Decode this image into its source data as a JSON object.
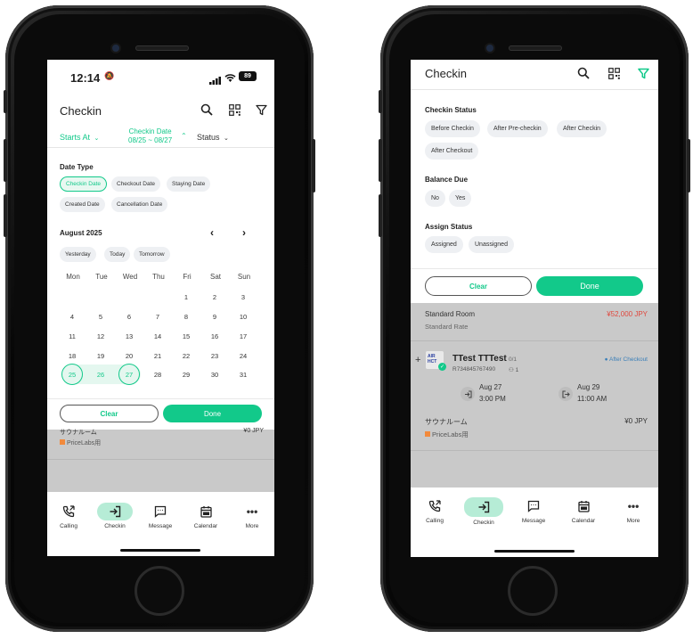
{
  "left": {
    "status": {
      "time": "12:14",
      "battery": "89"
    },
    "header": {
      "title": "Checkin"
    },
    "filters": {
      "starts_at": "Starts At",
      "checkin_date": "Checkin Date",
      "checkin_range": "08/25 ~ 08/27",
      "status": "Status"
    },
    "date_type": {
      "label": "Date Type",
      "options": [
        "Checkin Date",
        "Checkout Date",
        "Staying Date",
        "Created Date",
        "Cancellation Date"
      ],
      "selected": "Checkin Date"
    },
    "calendar": {
      "month": "August 2025",
      "quick": [
        "Yesterday",
        "Today",
        "Tomorrow"
      ],
      "weekdays": [
        "Mon",
        "Tue",
        "Wed",
        "Thu",
        "Fri",
        "Sat",
        "Sun"
      ],
      "weeks": [
        [
          "",
          "",
          "",
          "",
          "1",
          "2",
          "3"
        ],
        [
          "4",
          "5",
          "6",
          "7",
          "8",
          "9",
          "10"
        ],
        [
          "11",
          "12",
          "13",
          "14",
          "15",
          "16",
          "17"
        ],
        [
          "18",
          "19",
          "20",
          "21",
          "22",
          "23",
          "24"
        ],
        [
          "25",
          "26",
          "27",
          "28",
          "29",
          "30",
          "31"
        ]
      ],
      "range_start": "25",
      "range_end": "27"
    },
    "actions": {
      "clear": "Clear",
      "done": "Done"
    },
    "behind": {
      "room": "サウナルーム",
      "price": "¥0 JPY",
      "plan": "PriceLabs用"
    },
    "tabs": [
      "Calling",
      "Checkin",
      "Message",
      "Calendar",
      "More"
    ],
    "active_tab": "Checkin"
  },
  "right": {
    "header": {
      "title": "Checkin"
    },
    "checkin_status": {
      "label": "Checkin Status",
      "options": [
        "Before Checkin",
        "After Pre-checkin",
        "After Checkin",
        "After Checkout"
      ]
    },
    "balance_due": {
      "label": "Balance Due",
      "options": [
        "No",
        "Yes"
      ]
    },
    "assign_status": {
      "label": "Assign Status",
      "options": [
        "Assigned",
        "Unassigned"
      ]
    },
    "actions": {
      "clear": "Clear",
      "done": "Done"
    },
    "booking": {
      "room": "Standard Room",
      "rate": "Standard Rate",
      "price": "¥52,000 JPY",
      "guest": "TTest TTTest",
      "guest_count": "0/1",
      "code": "R734845767490",
      "people": "1",
      "status": "After Checkout",
      "checkin_date": "Aug 27",
      "checkin_time": "3:00 PM",
      "checkout_date": "Aug 29",
      "checkout_time": "11:00 AM",
      "room2": "サウナルーム",
      "price2": "¥0 JPY",
      "plan2": "PriceLabs用",
      "source_badge": "AIR HCT"
    },
    "tabs": [
      "Calling",
      "Checkin",
      "Message",
      "Calendar",
      "More"
    ],
    "active_tab": "Checkin"
  },
  "colors": {
    "accent": "#12c98a",
    "price_red": "#e0483e",
    "overlay": "#c9c9c9"
  }
}
